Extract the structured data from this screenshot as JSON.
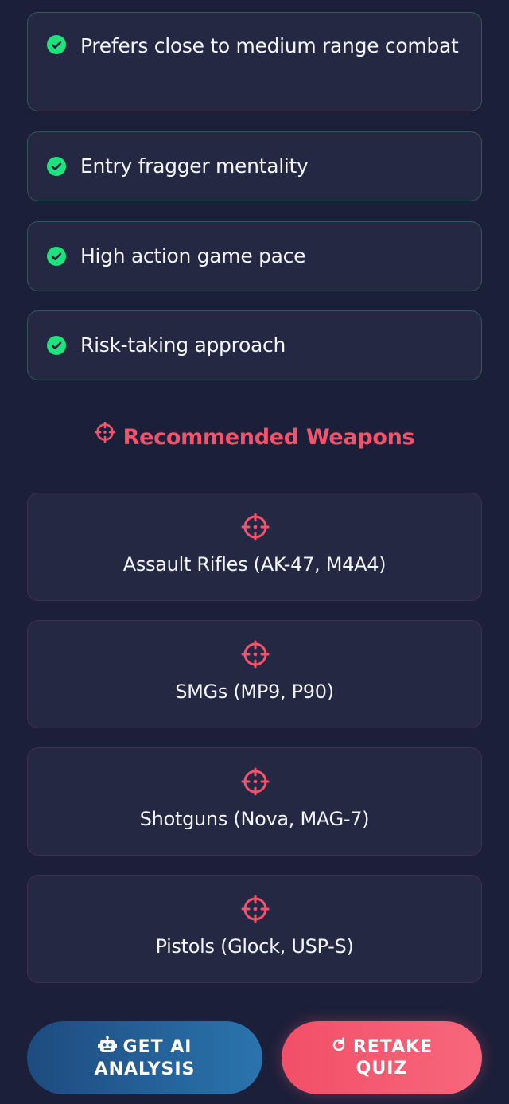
{
  "traits": [
    "Prefers close to medium range combat",
    "Entry fragger mentality",
    "High action game pace",
    "Risk-taking approach"
  ],
  "section": {
    "title": "Recommended Weapons",
    "icon": "crosshair-icon",
    "accent_color": "#f2546b"
  },
  "weapons": [
    {
      "label": "Assault Rifles (AK-47, M4A4)",
      "icon": "crosshair-icon"
    },
    {
      "label": "SMGs (MP9, P90)",
      "icon": "crosshair-icon"
    },
    {
      "label": "Shotguns (Nova, MAG-7)",
      "icon": "crosshair-icon"
    },
    {
      "label": "Pistols (Glock, USP-S)",
      "icon": "crosshair-icon"
    }
  ],
  "buttons": {
    "ai_analysis": {
      "line1": "GET AI",
      "line2": "ANALYSIS",
      "icon": "robot-icon"
    },
    "retake": {
      "line1": "RETAKE",
      "line2": "QUIZ",
      "icon": "redo-icon"
    }
  },
  "colors": {
    "check": "#1ee37c",
    "background": "#1b1f3a",
    "card": "#242843"
  }
}
